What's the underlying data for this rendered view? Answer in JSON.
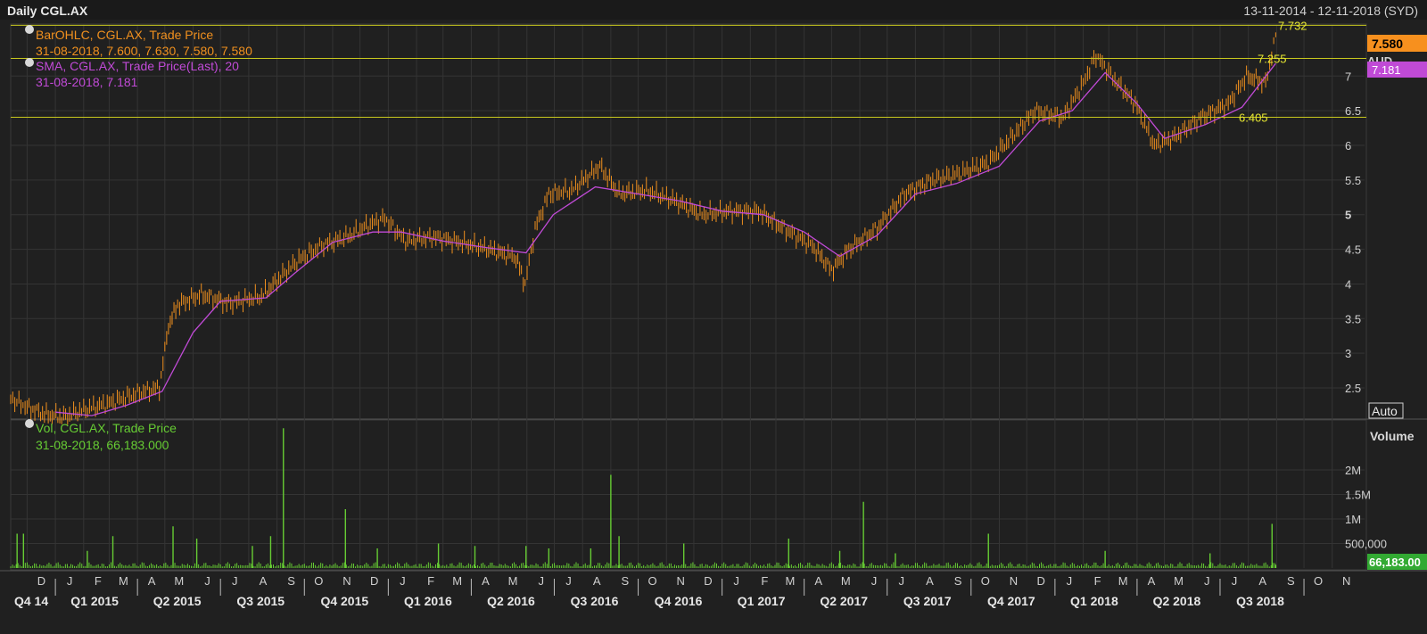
{
  "header": {
    "title": "Daily CGL.AX",
    "date_range": "13-11-2014 - 12-11-2018 (SYD)"
  },
  "colors": {
    "background": "#202020",
    "price_bars": "#f0901e",
    "sma": "#c04ad6",
    "volume": "#66cc33",
    "reference_lines": "#c8c81e",
    "grid": "#343434",
    "auto_button": "#e8e8e8"
  },
  "price_panel": {
    "legend": {
      "ohlc_label": "BarOHLC, CGL.AX, Trade Price",
      "ohlc_values": "31-08-2018, 7.600, 7.630, 7.580, 7.580",
      "sma_label": "SMA, CGL.AX, Trade Price(Last),  20",
      "sma_values": "31-08-2018, 7.181"
    },
    "axis_unit": "AUD",
    "last_price_badge": "7.580",
    "sma_badge": "7.181",
    "auto_label": "Auto",
    "reference_lines": [
      {
        "value": 7.732,
        "label": "7.732"
      },
      {
        "value": 7.255,
        "label": "7.255"
      },
      {
        "value": 6.405,
        "label": "6.405"
      }
    ]
  },
  "volume_panel": {
    "legend_label": "Vol, CGL.AX, Trade Price",
    "legend_values": "31-08-2018, 66,183.000",
    "axis_title": "Volume",
    "last_volume_badge": "66,183.00"
  },
  "chart_data": [
    {
      "type": "ohlc",
      "ylim": [
        2.05,
        7.75
      ],
      "y_ticks": [
        {
          "value": 7,
          "label": "7"
        },
        {
          "value": 6.5,
          "label": "6.5"
        },
        {
          "value": 6,
          "label": "6"
        },
        {
          "value": 5.5,
          "label": "5.5"
        },
        {
          "value": 5,
          "label": "5"
        },
        {
          "value": 4.5,
          "label": "4.5"
        },
        {
          "value": 4,
          "label": "4"
        },
        {
          "value": 3.5,
          "label": "3.5"
        },
        {
          "value": 3,
          "label": "3"
        },
        {
          "value": 2.5,
          "label": "2.5"
        }
      ],
      "x_range": [
        "2014-11-13",
        "2018-11-12"
      ],
      "series": [
        {
          "name": "BarOHLC, CGL.AX, Trade Price",
          "points": [
            {
              "date": "2014-11-13",
              "close": 2.35
            },
            {
              "date": "2014-12-01",
              "close": 2.22
            },
            {
              "date": "2014-12-20",
              "close": 2.12
            },
            {
              "date": "2015-01-10",
              "close": 2.08
            },
            {
              "date": "2015-02-01",
              "close": 2.18
            },
            {
              "date": "2015-03-01",
              "close": 2.28
            },
            {
              "date": "2015-04-01",
              "close": 2.42
            },
            {
              "date": "2015-04-25",
              "close": 2.5
            },
            {
              "date": "2015-05-05",
              "close": 3.4
            },
            {
              "date": "2015-05-15",
              "close": 3.7
            },
            {
              "date": "2015-06-10",
              "close": 3.85
            },
            {
              "date": "2015-07-10",
              "close": 3.72
            },
            {
              "date": "2015-08-15",
              "close": 3.82
            },
            {
              "date": "2015-09-05",
              "close": 4.1
            },
            {
              "date": "2015-09-25",
              "close": 4.35
            },
            {
              "date": "2015-10-20",
              "close": 4.55
            },
            {
              "date": "2015-11-20",
              "close": 4.7
            },
            {
              "date": "2015-12-10",
              "close": 4.85
            },
            {
              "date": "2015-12-28",
              "close": 4.95
            },
            {
              "date": "2016-01-20",
              "close": 4.62
            },
            {
              "date": "2016-02-20",
              "close": 4.68
            },
            {
              "date": "2016-03-20",
              "close": 4.6
            },
            {
              "date": "2016-04-20",
              "close": 4.5
            },
            {
              "date": "2016-05-20",
              "close": 4.38
            },
            {
              "date": "2016-05-30",
              "close": 4.0
            },
            {
              "date": "2016-06-10",
              "close": 4.8
            },
            {
              "date": "2016-06-25",
              "close": 5.3
            },
            {
              "date": "2016-07-20",
              "close": 5.35
            },
            {
              "date": "2016-08-20",
              "close": 5.7
            },
            {
              "date": "2016-09-10",
              "close": 5.3
            },
            {
              "date": "2016-10-10",
              "close": 5.35
            },
            {
              "date": "2016-11-10",
              "close": 5.2
            },
            {
              "date": "2016-12-10",
              "close": 5.0
            },
            {
              "date": "2017-01-10",
              "close": 5.05
            },
            {
              "date": "2017-02-10",
              "close": 5.05
            },
            {
              "date": "2017-03-10",
              "close": 4.8
            },
            {
              "date": "2017-04-10",
              "close": 4.55
            },
            {
              "date": "2017-05-01",
              "close": 4.2
            },
            {
              "date": "2017-05-20",
              "close": 4.5
            },
            {
              "date": "2017-06-20",
              "close": 4.8
            },
            {
              "date": "2017-07-20",
              "close": 5.3
            },
            {
              "date": "2017-08-20",
              "close": 5.5
            },
            {
              "date": "2017-09-20",
              "close": 5.6
            },
            {
              "date": "2017-10-20",
              "close": 5.75
            },
            {
              "date": "2017-11-20",
              "close": 6.2
            },
            {
              "date": "2017-12-10",
              "close": 6.5
            },
            {
              "date": "2018-01-10",
              "close": 6.4
            },
            {
              "date": "2018-02-01",
              "close": 6.9
            },
            {
              "date": "2018-02-15",
              "close": 7.3
            },
            {
              "date": "2018-03-10",
              "close": 6.9
            },
            {
              "date": "2018-03-30",
              "close": 6.6
            },
            {
              "date": "2018-04-20",
              "close": 6.0
            },
            {
              "date": "2018-05-10",
              "close": 6.1
            },
            {
              "date": "2018-06-10",
              "close": 6.4
            },
            {
              "date": "2018-07-10",
              "close": 6.6
            },
            {
              "date": "2018-07-30",
              "close": 7.0
            },
            {
              "date": "2018-08-20",
              "close": 6.9
            },
            {
              "date": "2018-08-31",
              "close": 7.58
            }
          ]
        },
        {
          "name": "SMA, CGL.AX, Trade Price(Last),  20",
          "points": [
            {
              "date": "2015-01-01",
              "value": 2.15
            },
            {
              "date": "2015-02-10",
              "value": 2.1
            },
            {
              "date": "2015-03-20",
              "value": 2.25
            },
            {
              "date": "2015-04-28",
              "value": 2.45
            },
            {
              "date": "2015-06-01",
              "value": 3.3
            },
            {
              "date": "2015-07-01",
              "value": 3.75
            },
            {
              "date": "2015-08-20",
              "value": 3.8
            },
            {
              "date": "2015-09-20",
              "value": 4.15
            },
            {
              "date": "2015-11-01",
              "value": 4.6
            },
            {
              "date": "2015-12-15",
              "value": 4.75
            },
            {
              "date": "2016-01-15",
              "value": 4.75
            },
            {
              "date": "2016-03-01",
              "value": 4.62
            },
            {
              "date": "2016-04-20",
              "value": 4.52
            },
            {
              "date": "2016-05-31",
              "value": 4.45
            },
            {
              "date": "2016-06-30",
              "value": 5.0
            },
            {
              "date": "2016-08-15",
              "value": 5.4
            },
            {
              "date": "2016-09-30",
              "value": 5.3
            },
            {
              "date": "2016-11-15",
              "value": 5.2
            },
            {
              "date": "2017-01-01",
              "value": 5.05
            },
            {
              "date": "2017-02-15",
              "value": 5.0
            },
            {
              "date": "2017-04-01",
              "value": 4.75
            },
            {
              "date": "2017-05-10",
              "value": 4.4
            },
            {
              "date": "2017-06-20",
              "value": 4.7
            },
            {
              "date": "2017-08-01",
              "value": 5.3
            },
            {
              "date": "2017-09-15",
              "value": 5.45
            },
            {
              "date": "2017-11-01",
              "value": 5.7
            },
            {
              "date": "2017-12-15",
              "value": 6.35
            },
            {
              "date": "2018-01-20",
              "value": 6.5
            },
            {
              "date": "2018-02-25",
              "value": 7.05
            },
            {
              "date": "2018-04-01",
              "value": 6.6
            },
            {
              "date": "2018-05-01",
              "value": 6.1
            },
            {
              "date": "2018-06-15",
              "value": 6.3
            },
            {
              "date": "2018-07-25",
              "value": 6.55
            },
            {
              "date": "2018-08-31",
              "value": 7.181
            }
          ]
        }
      ]
    },
    {
      "type": "bar",
      "ylim": [
        0,
        2800000
      ],
      "y_ticks": [
        {
          "value": 2000000,
          "label": "2M"
        },
        {
          "value": 1500000,
          "label": "1.5M"
        },
        {
          "value": 1000000,
          "label": "1M"
        },
        {
          "value": 500000,
          "label": "500,000"
        }
      ],
      "series": [
        {
          "name": "Vol, CGL.AX, Trade Price",
          "points": [
            {
              "date": "2014-11-20",
              "value": 700000
            },
            {
              "date": "2014-11-27",
              "value": 700000
            },
            {
              "date": "2015-02-05",
              "value": 350000
            },
            {
              "date": "2015-03-05",
              "value": 650000
            },
            {
              "date": "2015-05-10",
              "value": 850000
            },
            {
              "date": "2015-06-05",
              "value": 600000
            },
            {
              "date": "2015-08-05",
              "value": 450000
            },
            {
              "date": "2015-08-25",
              "value": 650000
            },
            {
              "date": "2015-09-08",
              "value": 2850000
            },
            {
              "date": "2015-11-15",
              "value": 1200000
            },
            {
              "date": "2015-12-20",
              "value": 400000
            },
            {
              "date": "2016-02-25",
              "value": 500000
            },
            {
              "date": "2016-04-05",
              "value": 450000
            },
            {
              "date": "2016-05-31",
              "value": 450000
            },
            {
              "date": "2016-06-25",
              "value": 400000
            },
            {
              "date": "2016-08-10",
              "value": 400000
            },
            {
              "date": "2016-09-01",
              "value": 1900000
            },
            {
              "date": "2016-09-10",
              "value": 650000
            },
            {
              "date": "2016-11-20",
              "value": 500000
            },
            {
              "date": "2017-03-15",
              "value": 600000
            },
            {
              "date": "2017-05-10",
              "value": 350000
            },
            {
              "date": "2017-06-05",
              "value": 1350000
            },
            {
              "date": "2017-07-10",
              "value": 300000
            },
            {
              "date": "2017-10-20",
              "value": 700000
            },
            {
              "date": "2018-02-25",
              "value": 350000
            },
            {
              "date": "2018-06-20",
              "value": 300000
            },
            {
              "date": "2018-08-27",
              "value": 900000
            },
            {
              "date": "2018-08-31",
              "value": 66183
            }
          ]
        }
      ]
    }
  ],
  "x_axis": {
    "month_labels": [
      {
        "date": "2014-12-01",
        "label": "D"
      },
      {
        "date": "2015-01-01",
        "label": "J"
      },
      {
        "date": "2015-02-01",
        "label": "F"
      },
      {
        "date": "2015-03-01",
        "label": "M"
      },
      {
        "date": "2015-04-01",
        "label": "A"
      },
      {
        "date": "2015-05-01",
        "label": "M"
      },
      {
        "date": "2015-06-01",
        "label": "J"
      },
      {
        "date": "2015-07-01",
        "label": "J"
      },
      {
        "date": "2015-08-01",
        "label": "A"
      },
      {
        "date": "2015-09-01",
        "label": "S"
      },
      {
        "date": "2015-10-01",
        "label": "O"
      },
      {
        "date": "2015-11-01",
        "label": "N"
      },
      {
        "date": "2015-12-01",
        "label": "D"
      },
      {
        "date": "2016-01-01",
        "label": "J"
      },
      {
        "date": "2016-02-01",
        "label": "F"
      },
      {
        "date": "2016-03-01",
        "label": "M"
      },
      {
        "date": "2016-04-01",
        "label": "A"
      },
      {
        "date": "2016-05-01",
        "label": "M"
      },
      {
        "date": "2016-06-01",
        "label": "J"
      },
      {
        "date": "2016-07-01",
        "label": "J"
      },
      {
        "date": "2016-08-01",
        "label": "A"
      },
      {
        "date": "2016-09-01",
        "label": "S"
      },
      {
        "date": "2016-10-01",
        "label": "O"
      },
      {
        "date": "2016-11-01",
        "label": "N"
      },
      {
        "date": "2016-12-01",
        "label": "D"
      },
      {
        "date": "2017-01-01",
        "label": "J"
      },
      {
        "date": "2017-02-01",
        "label": "F"
      },
      {
        "date": "2017-03-01",
        "label": "M"
      },
      {
        "date": "2017-04-01",
        "label": "A"
      },
      {
        "date": "2017-05-01",
        "label": "M"
      },
      {
        "date": "2017-06-01",
        "label": "J"
      },
      {
        "date": "2017-07-01",
        "label": "J"
      },
      {
        "date": "2017-08-01",
        "label": "A"
      },
      {
        "date": "2017-09-01",
        "label": "S"
      },
      {
        "date": "2017-10-01",
        "label": "O"
      },
      {
        "date": "2017-11-01",
        "label": "N"
      },
      {
        "date": "2017-12-01",
        "label": "D"
      },
      {
        "date": "2018-01-01",
        "label": "J"
      },
      {
        "date": "2018-02-01",
        "label": "F"
      },
      {
        "date": "2018-03-01",
        "label": "M"
      },
      {
        "date": "2018-04-01",
        "label": "A"
      },
      {
        "date": "2018-05-01",
        "label": "M"
      },
      {
        "date": "2018-06-01",
        "label": "J"
      },
      {
        "date": "2018-07-01",
        "label": "J"
      },
      {
        "date": "2018-08-01",
        "label": "A"
      },
      {
        "date": "2018-09-01",
        "label": "S"
      },
      {
        "date": "2018-10-01",
        "label": "O"
      },
      {
        "date": "2018-11-01",
        "label": "N"
      }
    ],
    "quarter_labels": [
      {
        "label": "Q4 14",
        "start": "2014-11-13",
        "end": "2015-01-01"
      },
      {
        "label": "Q1 2015",
        "start": "2015-01-01",
        "end": "2015-04-01"
      },
      {
        "label": "Q2 2015",
        "start": "2015-04-01",
        "end": "2015-07-01"
      },
      {
        "label": "Q3 2015",
        "start": "2015-07-01",
        "end": "2015-10-01"
      },
      {
        "label": "Q4 2015",
        "start": "2015-10-01",
        "end": "2016-01-01"
      },
      {
        "label": "Q1 2016",
        "start": "2016-01-01",
        "end": "2016-04-01"
      },
      {
        "label": "Q2 2016",
        "start": "2016-04-01",
        "end": "2016-07-01"
      },
      {
        "label": "Q3 2016",
        "start": "2016-07-01",
        "end": "2016-10-01"
      },
      {
        "label": "Q4 2016",
        "start": "2016-10-01",
        "end": "2017-01-01"
      },
      {
        "label": "Q1 2017",
        "start": "2017-01-01",
        "end": "2017-04-01"
      },
      {
        "label": "Q2 2017",
        "start": "2017-04-01",
        "end": "2017-07-01"
      },
      {
        "label": "Q3 2017",
        "start": "2017-07-01",
        "end": "2017-10-01"
      },
      {
        "label": "Q4 2017",
        "start": "2017-10-01",
        "end": "2018-01-01"
      },
      {
        "label": "Q1 2018",
        "start": "2018-01-01",
        "end": "2018-04-01"
      },
      {
        "label": "Q2 2018",
        "start": "2018-04-01",
        "end": "2018-07-01"
      },
      {
        "label": "Q3 2018",
        "start": "2018-07-01",
        "end": "2018-10-01"
      }
    ]
  }
}
